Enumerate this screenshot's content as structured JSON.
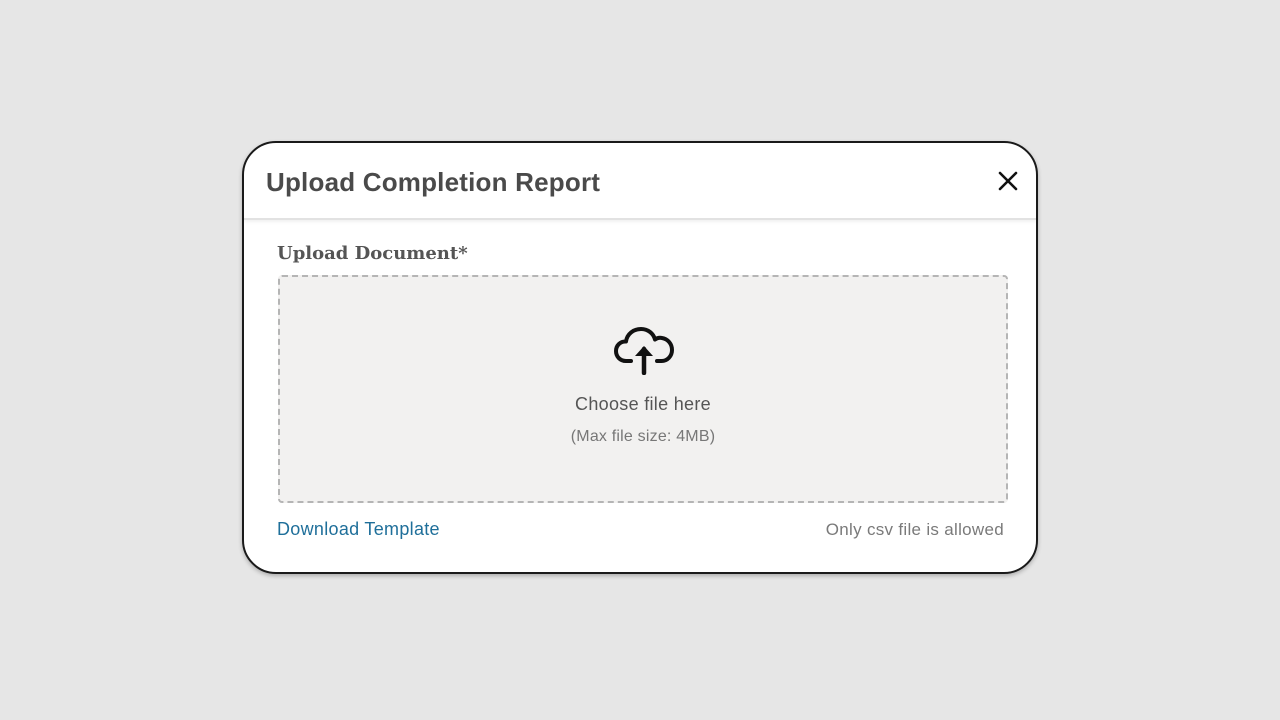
{
  "modal": {
    "title": "Upload Completion Report",
    "close_icon": "close-icon"
  },
  "upload": {
    "label": "Upload Document*",
    "icon": "cloud-upload-icon",
    "choose_text": "Choose file here",
    "max_size_text": "(Max file size: 4MB)"
  },
  "footer": {
    "download_link": "Download Template",
    "allowed_text": "Only csv file is allowed"
  },
  "colors": {
    "background": "#e6e6e6",
    "modal_background": "#ffffff",
    "dropzone_background": "#f2f1f0",
    "link": "#1f6f9a",
    "highlight": "#f8f35a"
  }
}
